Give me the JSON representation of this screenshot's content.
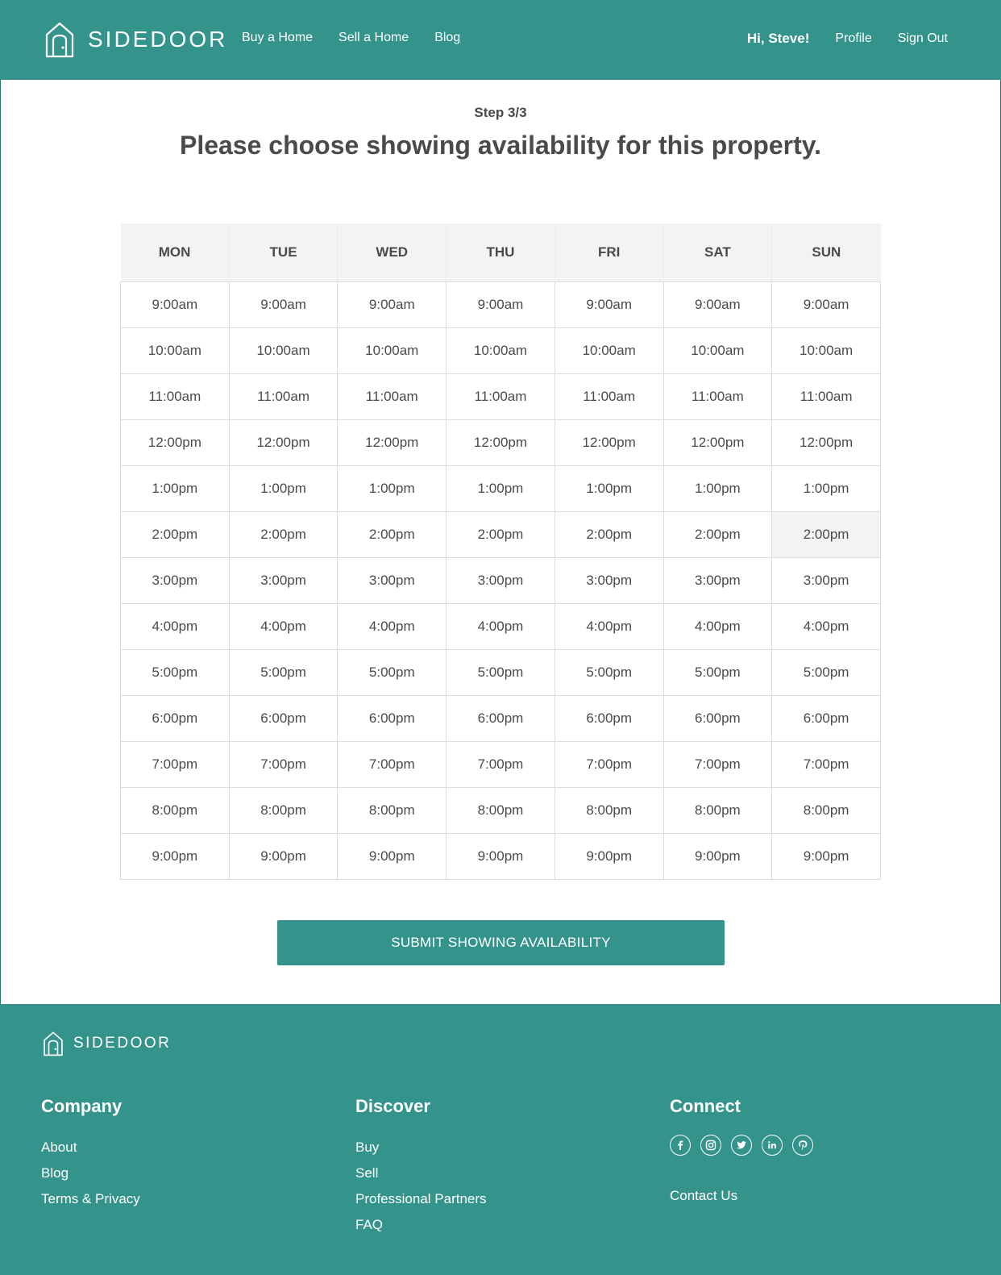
{
  "brand": {
    "name": "SIDEDOOR"
  },
  "nav": {
    "links": [
      "Buy a Home",
      "Sell a Home",
      "Blog"
    ],
    "greeting": "Hi, Steve!",
    "profile": "Profile",
    "sign_out": "Sign Out"
  },
  "intro": {
    "step": "Step 3/3",
    "title": "Please choose showing availability for this property."
  },
  "schedule": {
    "days": [
      "MON",
      "TUE",
      "WED",
      "THU",
      "FRI",
      "SAT",
      "SUN"
    ],
    "times": [
      "9:00am",
      "10:00am",
      "11:00am",
      "12:00pm",
      "1:00pm",
      "2:00pm",
      "3:00pm",
      "4:00pm",
      "5:00pm",
      "6:00pm",
      "7:00pm",
      "8:00pm",
      "9:00pm"
    ],
    "hovered": {
      "day": "SUN",
      "time": "2:00pm"
    }
  },
  "submit_label": "SUBMIT SHOWING AVAILABILITY",
  "footer": {
    "brand": "SIDEDOOR",
    "company": {
      "title": "Company",
      "links": [
        "About",
        "Blog",
        "Terms & Privacy"
      ]
    },
    "discover": {
      "title": "Discover",
      "links": [
        "Buy",
        "Sell",
        "Professional Partners",
        "FAQ"
      ]
    },
    "connect": {
      "title": "Connect",
      "social": [
        "facebook-icon",
        "instagram-icon",
        "twitter-icon",
        "linkedin-icon",
        "pinterest-icon"
      ],
      "contact": "Contact Us"
    }
  },
  "colors": {
    "primary": "#34948c",
    "text": "#4a4a4a",
    "header_bg": "#f3f3f3",
    "border": "#dcdcdc"
  }
}
